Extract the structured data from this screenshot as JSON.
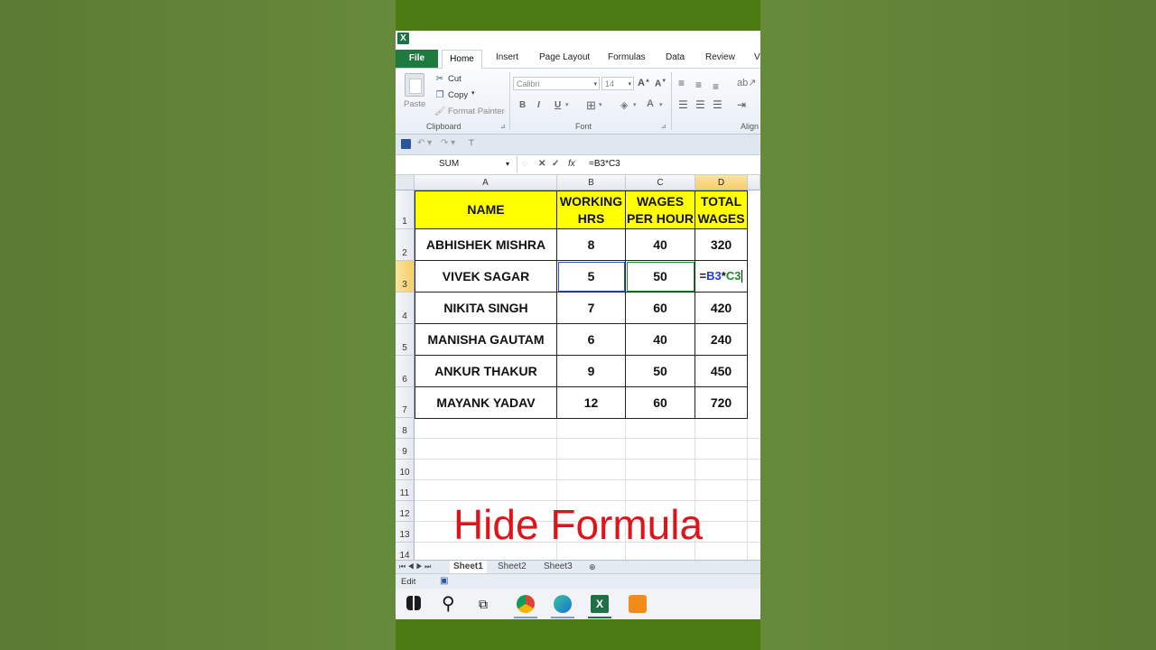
{
  "ribbon": {
    "tabs": [
      "File",
      "Home",
      "Insert",
      "Page Layout",
      "Formulas",
      "Data",
      "Review",
      "Vi"
    ],
    "clipboard": {
      "paste": "Paste",
      "cut": "Cut",
      "copy": "Copy",
      "format_painter": "Format Painter",
      "group": "Clipboard"
    },
    "font": {
      "name": "Calibri",
      "size": "14",
      "group": "Font"
    },
    "alignment_group": "Align"
  },
  "formula_bar": {
    "name_box": "SUM",
    "fx": "fx",
    "formula": "=B3*C3"
  },
  "grid": {
    "columns": [
      "A",
      "B",
      "C",
      "D"
    ],
    "row_numbers": [
      "1",
      "2",
      "3",
      "4",
      "5",
      "6",
      "7",
      "8",
      "9",
      "10",
      "11",
      "12",
      "13",
      "14"
    ],
    "headers": [
      "NAME",
      "WORKING HRS",
      "WAGES PER HOUR",
      "TOTAL WAGES"
    ],
    "rows": [
      [
        "ABHISHEK MISHRA",
        "8",
        "40",
        "320"
      ],
      [
        "VIVEK SAGAR",
        "5",
        "50",
        "=B3*C3"
      ],
      [
        "NIKITA SINGH",
        "7",
        "60",
        "420"
      ],
      [
        "MANISHA GAUTAM",
        "6",
        "40",
        "240"
      ],
      [
        "ANKUR THAKUR",
        "9",
        "50",
        "450"
      ],
      [
        "MAYANK YADAV",
        "12",
        "60",
        "720"
      ]
    ],
    "edit_parts": {
      "eq": "=",
      "b3": "B3",
      "star": "*",
      "c3": "C3"
    }
  },
  "overlay_title": "Hide Formula",
  "sheets": [
    "Sheet1",
    "Sheet2",
    "Sheet3"
  ],
  "status": {
    "mode": "Edit"
  },
  "colors": {
    "header_fill": "#ffff00",
    "title_red": "#e0131a",
    "ref_blue": "#1f3fd1",
    "ref_green": "#1b8a2a",
    "excel_green": "#1f7a3f"
  }
}
